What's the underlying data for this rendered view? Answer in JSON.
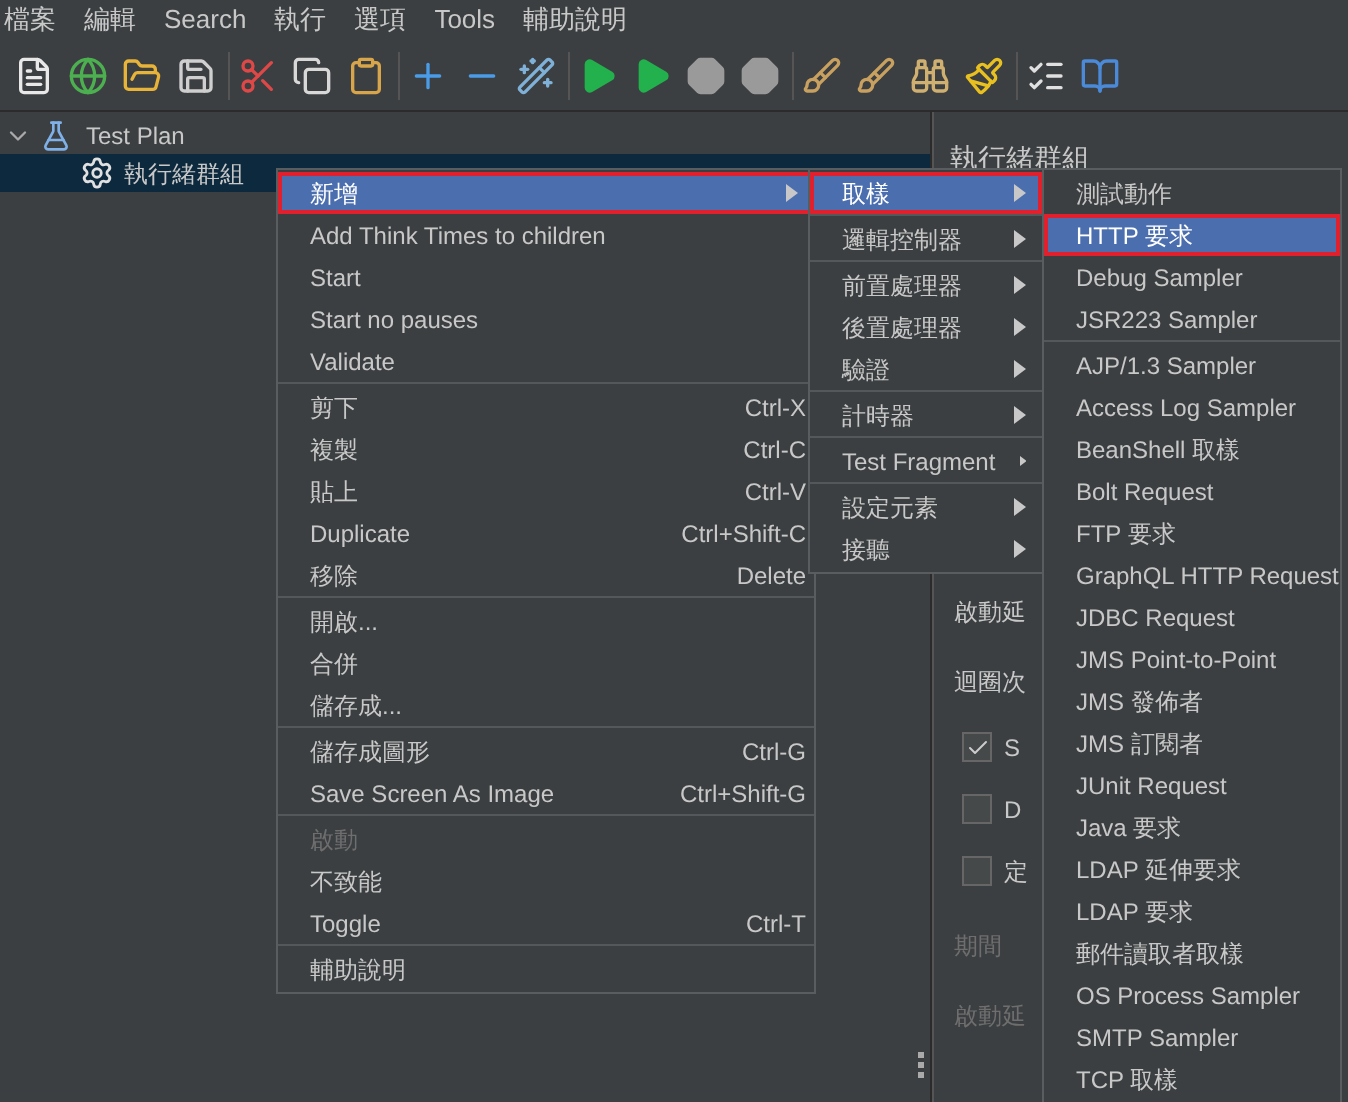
{
  "menu_bar": [
    "檔案",
    "編輯",
    "Search",
    "執行",
    "選項",
    "Tools",
    "輔助說明"
  ],
  "tree": [
    {
      "label": "Test Plan",
      "expanded": true,
      "selected": false,
      "children": [
        {
          "label": "執行緒群組",
          "selected": true
        }
      ]
    }
  ],
  "right_panel": {
    "title": "執行緒群組",
    "rows": [
      {
        "kind": "label",
        "text": "啟動延",
        "disabled": false
      },
      {
        "kind": "label",
        "text": "迴圈次",
        "disabled": false
      },
      {
        "kind": "checkbox",
        "text": "S",
        "checked": true
      },
      {
        "kind": "checkbox",
        "text": "D",
        "checked": false
      },
      {
        "kind": "checkbox",
        "text": "定",
        "checked": false
      },
      {
        "kind": "label",
        "text": "期間",
        "disabled": true
      },
      {
        "kind": "label",
        "text": "啟動延",
        "disabled": true
      }
    ]
  },
  "context_menu": {
    "groups": [
      [
        {
          "label": "新增",
          "submenu": true,
          "selected": true
        },
        {
          "label": "Add Think Times to children",
          "selected": false
        },
        {
          "label": "Start",
          "selected": false
        },
        {
          "label": "Start no pauses",
          "selected": false
        },
        {
          "label": "Validate",
          "selected": false
        }
      ],
      [
        {
          "label": "剪下",
          "shortcut": "Ctrl-X",
          "selected": false
        },
        {
          "label": "複製",
          "shortcut": "Ctrl-C",
          "selected": false
        },
        {
          "label": "貼上",
          "shortcut": "Ctrl-V",
          "selected": false
        },
        {
          "label": "Duplicate",
          "shortcut": "Ctrl+Shift-C",
          "selected": false
        },
        {
          "label": "移除",
          "shortcut": "Delete",
          "selected": false
        }
      ],
      [
        {
          "label": "開啟...",
          "selected": false
        },
        {
          "label": "合併",
          "selected": false
        },
        {
          "label": "儲存成...",
          "selected": false
        }
      ],
      [
        {
          "label": "儲存成圖形",
          "shortcut": "Ctrl-G",
          "selected": false
        },
        {
          "label": "Save Screen As Image",
          "shortcut": "Ctrl+Shift-G",
          "selected": false
        }
      ],
      [
        {
          "label": "啟動",
          "disabled": true,
          "selected": false
        },
        {
          "label": "不致能",
          "selected": false
        },
        {
          "label": "Toggle",
          "shortcut": "Ctrl-T",
          "selected": false
        }
      ],
      [
        {
          "label": "輔助說明",
          "selected": false
        }
      ]
    ]
  },
  "add_submenu": {
    "groups": [
      [
        {
          "label": "取樣",
          "submenu": true,
          "selected": true
        }
      ],
      [
        {
          "label": "邏輯控制器",
          "submenu": true,
          "selected": false
        }
      ],
      [
        {
          "label": "前置處理器",
          "submenu": true,
          "selected": false
        },
        {
          "label": "後置處理器",
          "submenu": true,
          "selected": false
        },
        {
          "label": "驗證",
          "submenu": true,
          "selected": false
        }
      ],
      [
        {
          "label": "計時器",
          "submenu": true,
          "selected": false
        }
      ],
      [
        {
          "label": "Test Fragment",
          "submenu": true,
          "selected": false
        }
      ],
      [
        {
          "label": "設定元素",
          "submenu": true,
          "selected": false
        },
        {
          "label": "接聽",
          "submenu": true,
          "selected": false
        }
      ]
    ]
  },
  "sampler_submenu": {
    "groups": [
      [
        {
          "label": "測試動作",
          "selected": false
        },
        {
          "label": "HTTP 要求",
          "selected": true
        },
        {
          "label": "Debug Sampler",
          "selected": false
        },
        {
          "label": "JSR223 Sampler",
          "selected": false
        }
      ],
      [
        {
          "label": "AJP/1.3 Sampler",
          "selected": false
        },
        {
          "label": "Access Log Sampler",
          "selected": false
        },
        {
          "label": "BeanShell 取樣",
          "selected": false
        },
        {
          "label": "Bolt Request",
          "selected": false
        },
        {
          "label": "FTP 要求",
          "selected": false
        },
        {
          "label": "GraphQL HTTP Request",
          "selected": false
        },
        {
          "label": "JDBC Request",
          "selected": false
        },
        {
          "label": "JMS Point-to-Point",
          "selected": false
        },
        {
          "label": "JMS 發佈者",
          "selected": false
        },
        {
          "label": "JMS 訂閱者",
          "selected": false
        },
        {
          "label": "JUnit Request",
          "selected": false
        },
        {
          "label": "Java 要求",
          "selected": false
        },
        {
          "label": "LDAP 延伸要求",
          "selected": false
        },
        {
          "label": "LDAP 要求",
          "selected": false
        },
        {
          "label": "郵件讀取者取樣",
          "selected": false
        },
        {
          "label": "OS Process Sampler",
          "selected": false
        },
        {
          "label": "SMTP Sampler",
          "selected": false
        },
        {
          "label": "TCP 取樣",
          "selected": false
        }
      ]
    ]
  }
}
